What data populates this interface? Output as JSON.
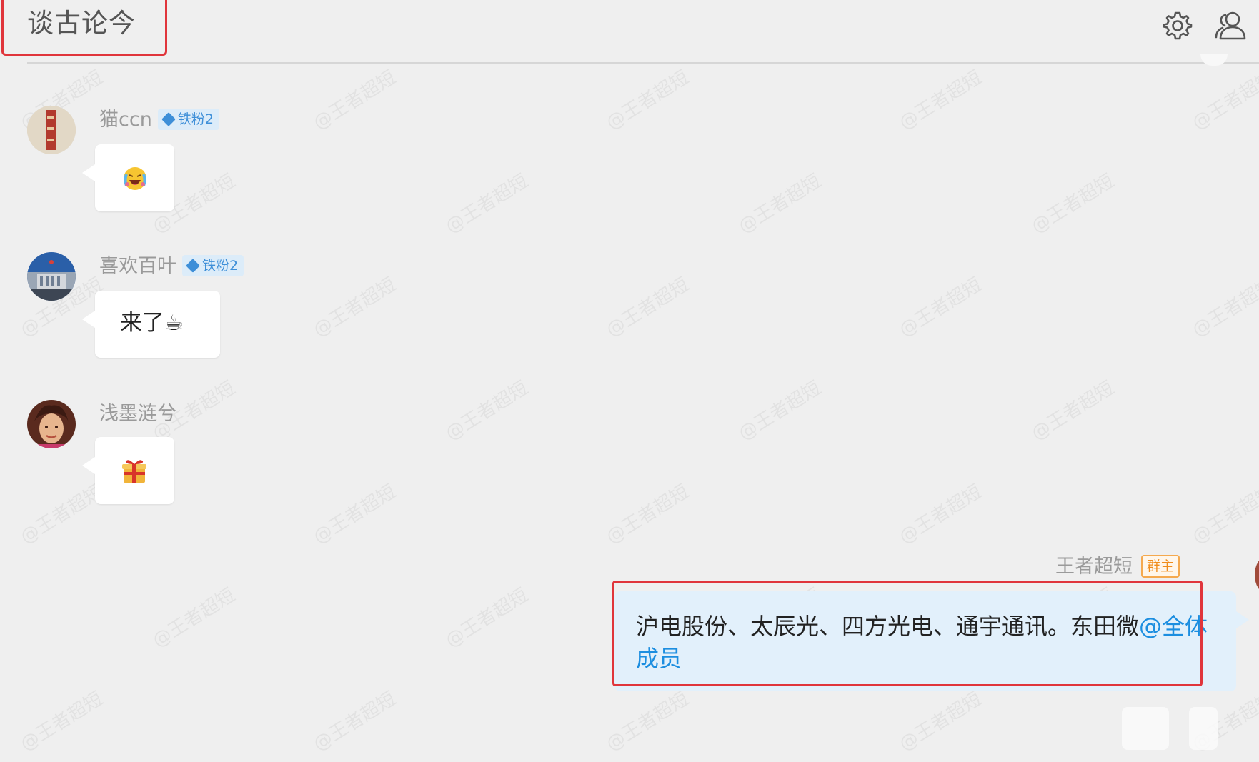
{
  "header": {
    "title": "谈古论今",
    "settings_icon": "gear-icon",
    "members_icon": "group-members-icon"
  },
  "messages": [
    {
      "sender": "猫ccn",
      "badge": "铁粉2",
      "content_type": "emoji",
      "content_icon": "laughing-tears-emoji"
    },
    {
      "sender": "喜欢百叶",
      "badge": "铁粉2",
      "content_type": "text",
      "text": "来了",
      "text_emoji": "☕"
    },
    {
      "sender": "浅墨涟兮",
      "content_type": "emoji",
      "content_icon": "gift-emoji"
    }
  ],
  "own_message": {
    "sender": "王者超短",
    "role_badge": "群主",
    "text": "沪电股份、太辰光、四方光电、通宇通讯。东田微",
    "mention": "@全体成员"
  },
  "watermark_text": "@王者超短",
  "colors": {
    "background": "#efefef",
    "highlight_border": "#e0353b",
    "mention": "#1c8ee0",
    "own_bubble": "#e2f0fb",
    "fan_badge": "#3e8fd8",
    "owner_badge": "#f08c1a"
  }
}
